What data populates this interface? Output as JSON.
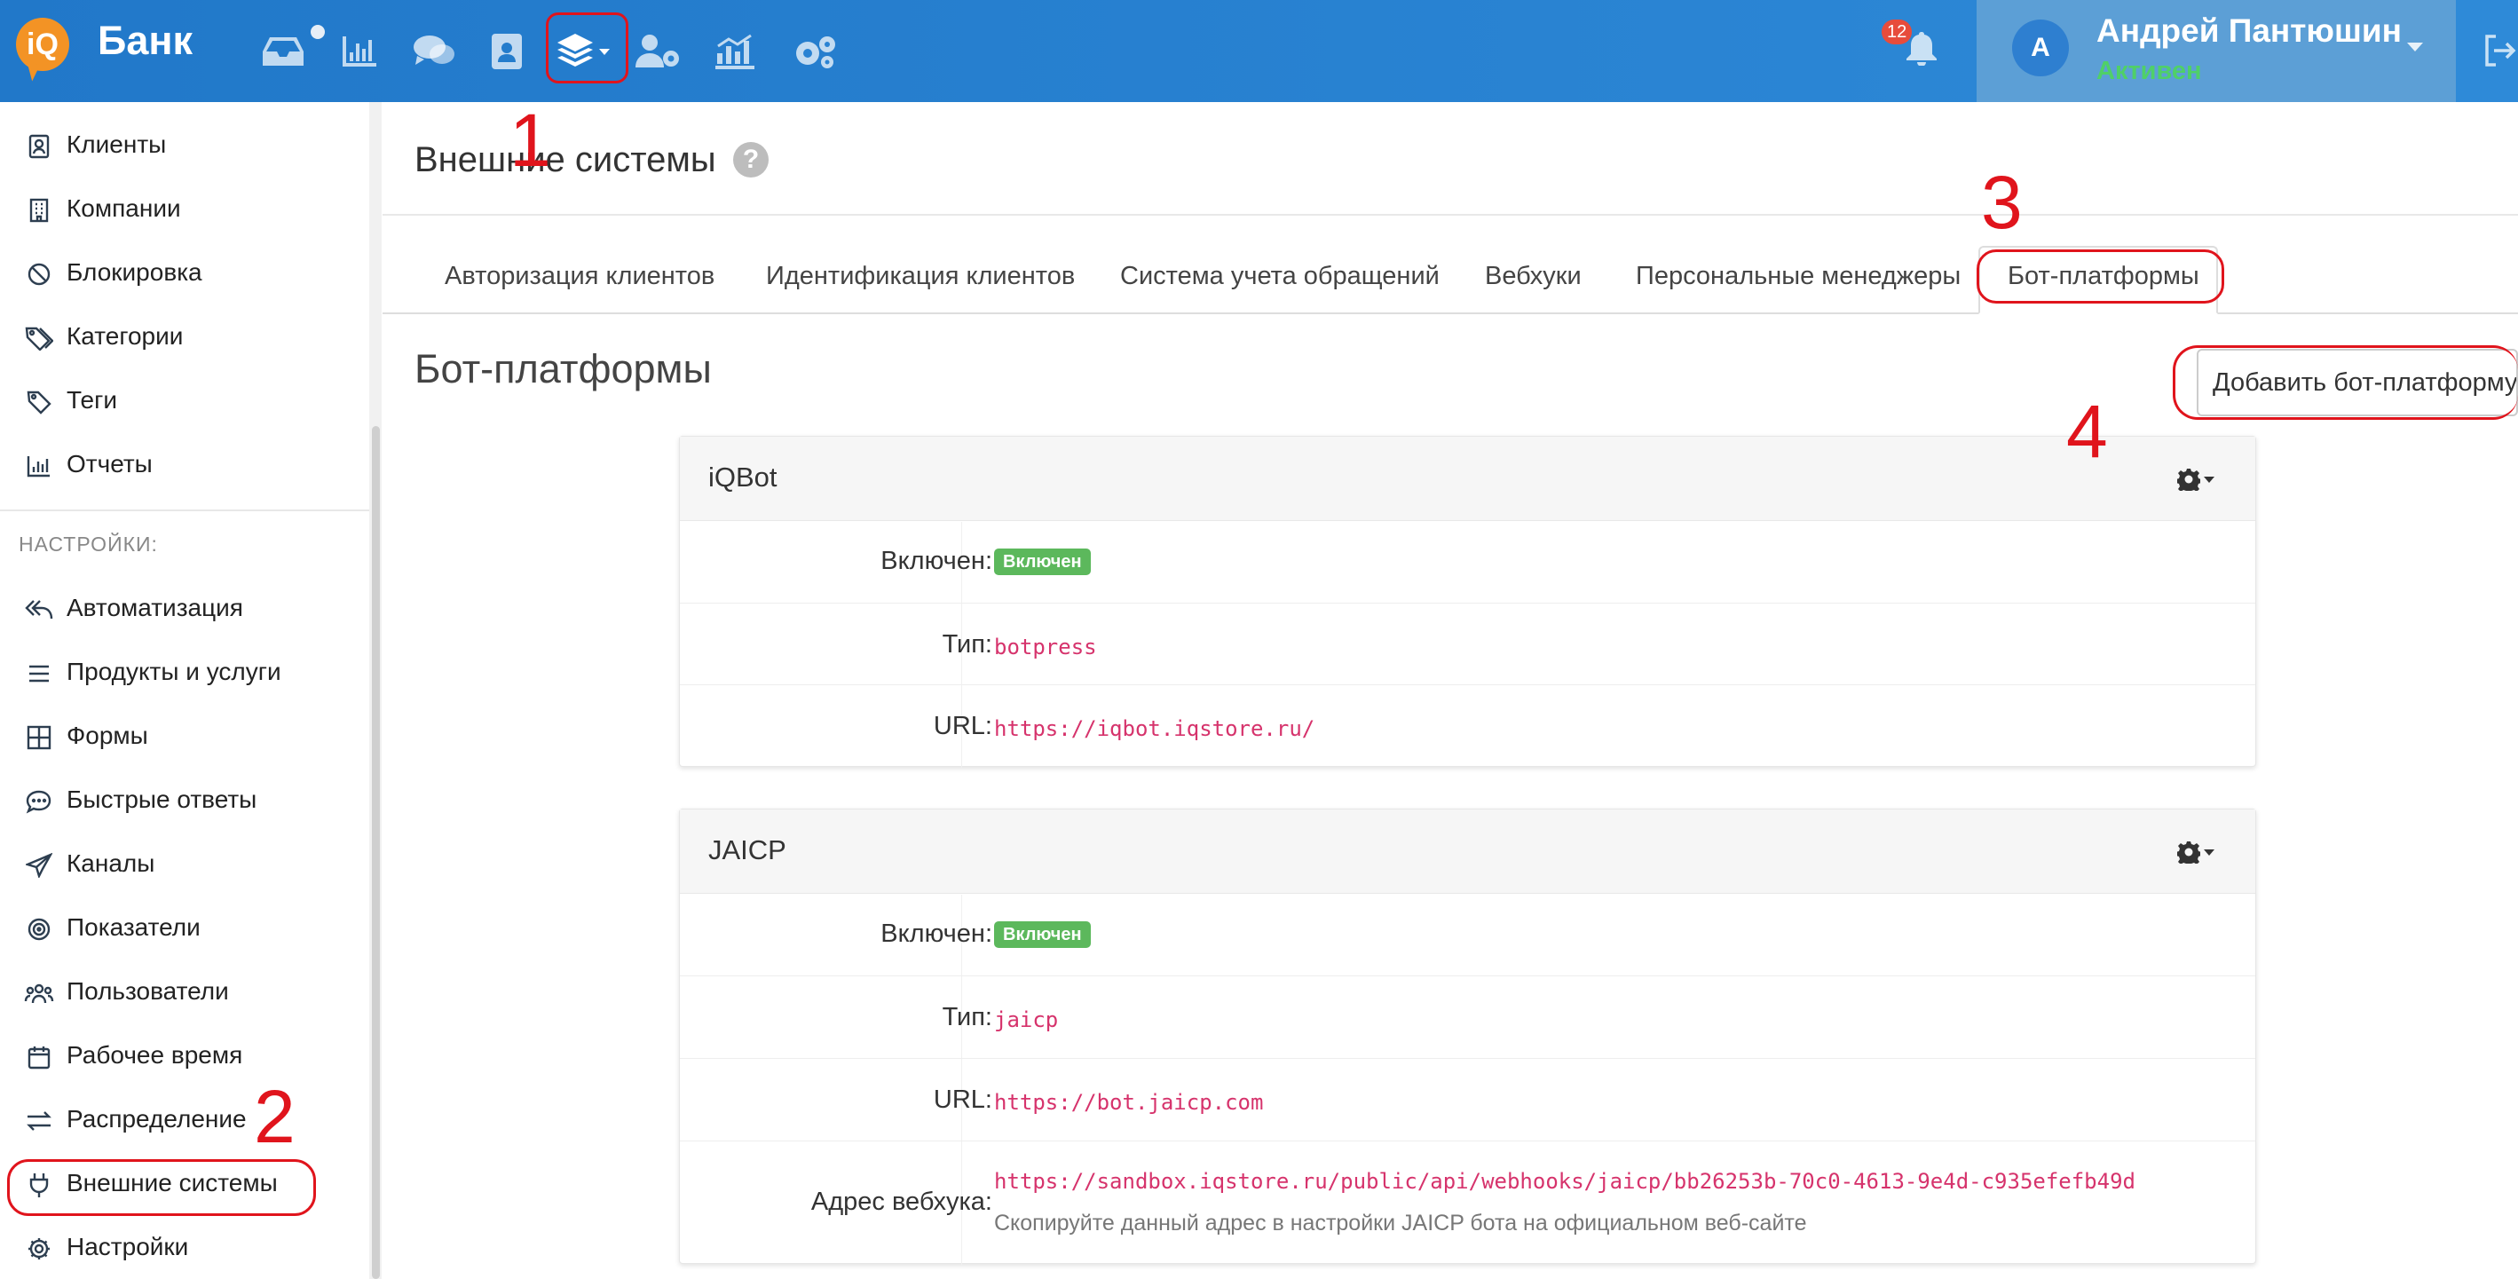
{
  "topbar": {
    "logo_text": "iQ",
    "app_title": "Банк",
    "nav_icons": [
      "inbox-icon",
      "bar-chart-icon",
      "chat-icon",
      "contacts-icon",
      "layers-icon",
      "users-gear-icon",
      "analytics-icon",
      "settings-icons"
    ],
    "notifications_count": "12",
    "user": {
      "initial": "A",
      "name": "Андрей Пантюшин",
      "status": "Активен"
    }
  },
  "sidebar": {
    "items": [
      {
        "label": "Клиенты",
        "icon": "contact-card-icon"
      },
      {
        "label": "Компании",
        "icon": "building-icon"
      },
      {
        "label": "Блокировка",
        "icon": "ban-icon"
      },
      {
        "label": "Категории",
        "icon": "tags-icon"
      },
      {
        "label": "Теги",
        "icon": "tag-icon"
      },
      {
        "label": "Отчеты",
        "icon": "bar-chart-icon"
      }
    ],
    "settings_heading": "НАСТРОЙКИ:",
    "settings_items": [
      {
        "label": "Автоматизация",
        "icon": "reply-all-icon"
      },
      {
        "label": "Продукты и услуги",
        "icon": "list-icon"
      },
      {
        "label": "Формы",
        "icon": "grid-icon"
      },
      {
        "label": "Быстрые ответы",
        "icon": "comment-dots-icon"
      },
      {
        "label": "Каналы",
        "icon": "paper-plane-icon"
      },
      {
        "label": "Показатели",
        "icon": "target-icon"
      },
      {
        "label": "Пользователи",
        "icon": "users-icon"
      },
      {
        "label": "Рабочее время",
        "icon": "calendar-icon"
      },
      {
        "label": "Распределение",
        "icon": "exchange-icon"
      },
      {
        "label": "Внешние системы",
        "icon": "plug-icon"
      },
      {
        "label": "Настройки",
        "icon": "cog-icon"
      }
    ]
  },
  "main": {
    "page_title": "Внешние системы",
    "tabs": [
      {
        "label": "Авторизация клиентов"
      },
      {
        "label": "Идентификация клиентов"
      },
      {
        "label": "Система учета обращений"
      },
      {
        "label": "Вебхуки"
      },
      {
        "label": "Персональные менеджеры"
      },
      {
        "label": "Бот-платформы",
        "active": true
      }
    ],
    "section_title": "Бот-платформы",
    "add_button": "Добавить бот-платформу",
    "cards": [
      {
        "title": "iQBot",
        "rows": [
          {
            "label": "Включен:",
            "badge": "Включен"
          },
          {
            "label": "Тип:",
            "value": "botpress"
          },
          {
            "label": "URL:",
            "value": "https://iqbot.iqstore.ru/"
          }
        ]
      },
      {
        "title": "JAICP",
        "rows": [
          {
            "label": "Включен:",
            "badge": "Включен"
          },
          {
            "label": "Тип:",
            "value": "jaicp"
          },
          {
            "label": "URL:",
            "value": "https://bot.jaicp.com"
          },
          {
            "label": "Адрес вебхука:",
            "value": "https://sandbox.iqstore.ru/public/api/webhooks/jaicp/bb26253b-70c0-4613-9e4d-c935efefb49d",
            "hint": "Скопируйте данный адрес в настройки JAICP бота на официальном веб-сайте"
          }
        ]
      }
    ]
  },
  "annotations": [
    "1",
    "2",
    "3",
    "4"
  ],
  "colors": {
    "topbar": "#2178c9",
    "accent_orange": "#f39325",
    "status_green": "#4fd068",
    "badge_green": "#5cb85c",
    "code_pink": "#d6336c",
    "annotation_red": "#e0141c"
  }
}
